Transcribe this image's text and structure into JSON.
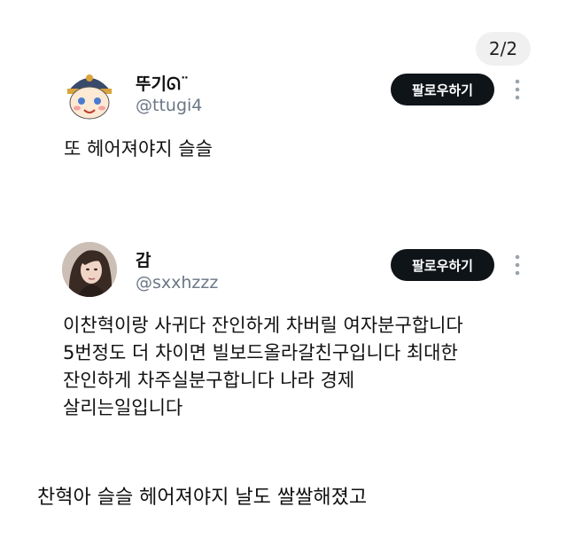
{
  "pagination": {
    "counter": "2/2"
  },
  "tweets": [
    {
      "display_name": "뚜기ᘏ¨",
      "handle": "@ttugi4",
      "follow_label": "팔로우하기",
      "text": "또 헤어져야지 슬슬"
    },
    {
      "display_name": "감",
      "handle": "@sxxhzzz",
      "follow_label": "팔로우하기",
      "text": "이찬혁이랑 사귀다 잔인하게 차버릴 여자분구합니다\n5번정도 더 차이면 빌보드올라갈친구입니다 최대한\n잔인하게 차주실분구합니다 나라 경제\n살리는일입니다"
    }
  ],
  "caption": "찬혁아 슬슬 헤어져야지 날도 쌀쌀해졌고",
  "colors": {
    "follow_button_bg": "#0f1419",
    "handle": "#6b7785",
    "counter_bg": "#f0f0f0"
  },
  "icons": [
    "avatar-cartoon",
    "avatar-photo",
    "more-icon"
  ]
}
